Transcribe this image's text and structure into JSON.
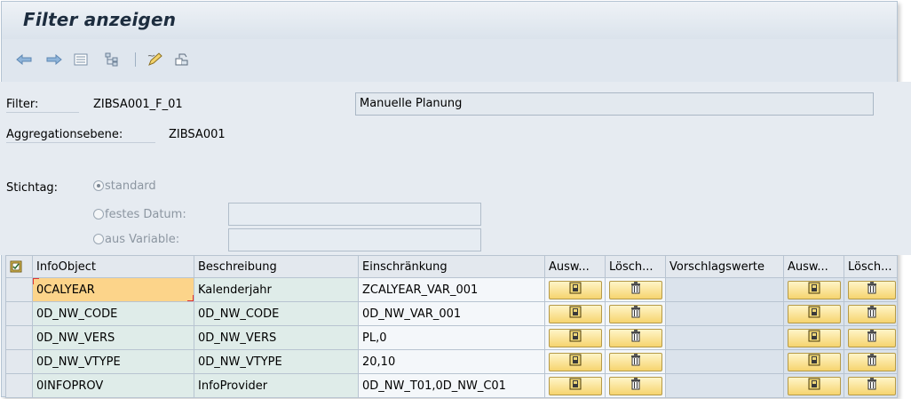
{
  "window": {
    "title": "Filter anzeigen"
  },
  "toolbar": {
    "icons": [
      "back-arrow-icon",
      "forward-arrow-icon",
      "list-icon",
      "hierarchy-icon",
      "edit-pencil-icon",
      "transport-icon"
    ]
  },
  "header": {
    "filter_label": "Filter:",
    "filter_value": "ZIBSA001_F_01",
    "filter_description": "Manuelle Planung",
    "aggregation_label": "Aggregationsebene:",
    "aggregation_value": "ZIBSA001",
    "stichtag_label": "Stichtag:",
    "radio_standard": "standard",
    "radio_festes_datum": "festes Datum:",
    "radio_aus_variable": "aus Variable:",
    "selected_radio": "standard"
  },
  "table": {
    "columns": [
      "InfoObject",
      "Beschreibung",
      "Einschränkung",
      "Ausw...",
      "Lösch...",
      "Vorschlagswerte",
      "Ausw...",
      "Lösch..."
    ],
    "rows": [
      {
        "infoobject": "0CALYEAR",
        "beschreibung": "Kalenderjahr",
        "einschraenkung": "ZCALYEAR_VAR_001",
        "vorschlagswerte": ""
      },
      {
        "infoobject": "0D_NW_CODE",
        "beschreibung": "0D_NW_CODE",
        "einschraenkung": "0D_NW_VAR_001",
        "vorschlagswerte": ""
      },
      {
        "infoobject": "0D_NW_VERS",
        "beschreibung": "0D_NW_VERS",
        "einschraenkung": "PL,0",
        "vorschlagswerte": ""
      },
      {
        "infoobject": "0D_NW_VTYPE",
        "beschreibung": "0D_NW_VTYPE",
        "einschraenkung": "20,10",
        "vorschlagswerte": ""
      },
      {
        "infoobject": "0INFOPROV",
        "beschreibung": "InfoProvider",
        "einschraenkung": "0D_NW_T01,0D_NW_C01",
        "vorschlagswerte": ""
      }
    ]
  },
  "colors": {
    "active_cell": "#fcd48a",
    "green_cell": "#dfece9",
    "button": "#f6d46f",
    "frame": "#dfe6ee"
  }
}
